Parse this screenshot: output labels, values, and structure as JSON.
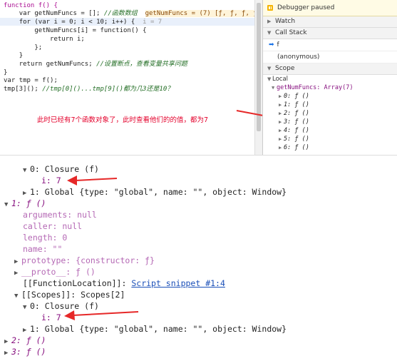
{
  "code": {
    "l1": "function f() {",
    "l2_a": "var getNumFuncs = [];",
    "l2_cm": "//函数数组",
    "l2_eval": "getNumFuncs = (7) [ƒ, ƒ, ƒ, ƒ, ƒ,",
    "l3_a": "for (var i = 0; i",
    "l3_b": "< 10; i++) {",
    "l3_eval": "i = 7",
    "l4": "getNumFuncs[i] = function() {",
    "l5": "return i;",
    "l6": "};",
    "l7": "}",
    "l8_a": "return getNumFuncs;",
    "l8_cm": "//设置断点，查看变量共享问题",
    "l9": "}",
    "l10": "var tmp = f();",
    "l11_a": "tmp[3]();",
    "l11_cm": "//tmp[0]()...tmp[9]()都为几3还是10？"
  },
  "annotation": "此时已经有7个函数对象了，此时查看他们的的值，都为7",
  "debugger": {
    "paused": "Debugger paused",
    "watch": "Watch",
    "call_stack": "Call Stack",
    "frames": [
      "f",
      "(anonymous)"
    ],
    "scope": "Scope",
    "local": "Local",
    "getNumFuncs": "getNumFuncs: Array(7)",
    "items": [
      "0: ƒ ()",
      "1: ƒ ()",
      "2: ƒ ()",
      "3: ƒ ()",
      "4: ƒ ()",
      "5: ƒ ()",
      "6: ƒ ()"
    ]
  },
  "tree": {
    "closure0": "0: Closure (f)",
    "i_val": "i: 7",
    "global": "1: Global {type: \"global\", name: \"\", object: Window}",
    "fn1": "1: ƒ ()",
    "arguments": "arguments: null",
    "caller": "caller: null",
    "length": "length: 0",
    "name": "name: \"\"",
    "prototype": "prototype: {constructor: ƒ}",
    "proto": "__proto__: ƒ ()",
    "fnloc_key": "[[FunctionLocation]]:",
    "fnloc_val": "Script snippet #1:4",
    "scopes": "[[Scopes]]: Scopes[2]",
    "closure1": "0: Closure (f)",
    "i_val2": "i: 7",
    "global2": "1: Global {type: \"global\", name: \"\", object: Window}",
    "fn2": "2: ƒ ()",
    "fn3": "3: ƒ ()"
  },
  "colors": {
    "red_arrow": "#e62828",
    "note": "#e4002b"
  }
}
